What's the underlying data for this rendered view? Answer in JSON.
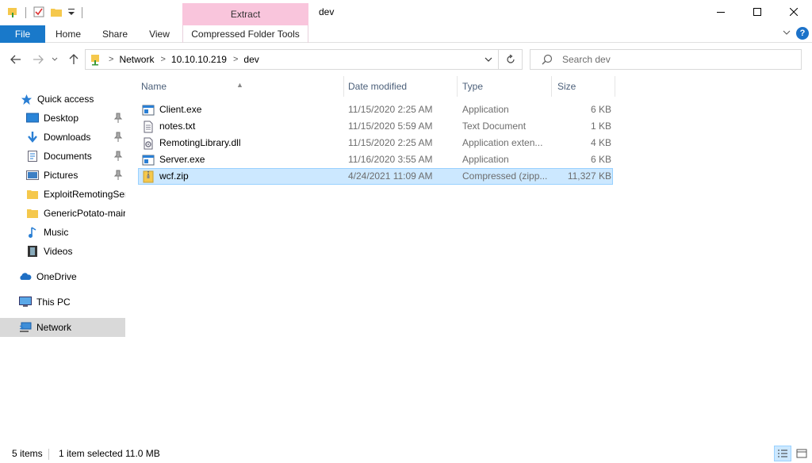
{
  "window": {
    "title": "dev",
    "context_tab_header": "Extract"
  },
  "ribbon": {
    "tabs": [
      "File",
      "Home",
      "Share",
      "View",
      "Compressed Folder Tools"
    ]
  },
  "address": {
    "crumbs": [
      "Network",
      "10.10.10.219",
      "dev"
    ],
    "search_placeholder": "Search dev"
  },
  "sidebar": {
    "items": [
      {
        "label": "Quick access",
        "icon": "star-icon",
        "pinned": false
      },
      {
        "label": "Desktop",
        "icon": "desktop-icon",
        "pinned": true
      },
      {
        "label": "Downloads",
        "icon": "download-arrow-icon",
        "pinned": true
      },
      {
        "label": "Documents",
        "icon": "documents-icon",
        "pinned": true
      },
      {
        "label": "Pictures",
        "icon": "pictures-icon",
        "pinned": true
      },
      {
        "label": "ExploitRemotingSer",
        "icon": "folder-icon",
        "pinned": false
      },
      {
        "label": "GenericPotato-mair",
        "icon": "folder-icon",
        "pinned": false
      },
      {
        "label": "Music",
        "icon": "music-note-icon",
        "pinned": false
      },
      {
        "label": "Videos",
        "icon": "film-icon",
        "pinned": false
      },
      {
        "label": "OneDrive",
        "icon": "cloud-icon",
        "pinned": false
      },
      {
        "label": "This PC",
        "icon": "computer-icon",
        "pinned": false
      },
      {
        "label": "Network",
        "icon": "network-icon",
        "pinned": false,
        "selected": true
      }
    ]
  },
  "files": {
    "columns": [
      "Name",
      "Date modified",
      "Type",
      "Size"
    ],
    "rows": [
      {
        "name": "Client.exe",
        "date": "11/15/2020 2:25 AM",
        "type": "Application",
        "size": "6 KB",
        "icon": "exe-icon"
      },
      {
        "name": "notes.txt",
        "date": "11/15/2020 5:59 AM",
        "type": "Text Document",
        "size": "1 KB",
        "icon": "text-file-icon"
      },
      {
        "name": "RemotingLibrary.dll",
        "date": "11/15/2020 2:25 AM",
        "type": "Application exten...",
        "size": "4 KB",
        "icon": "dll-icon"
      },
      {
        "name": "Server.exe",
        "date": "11/16/2020 3:55 AM",
        "type": "Application",
        "size": "6 KB",
        "icon": "exe-icon"
      },
      {
        "name": "wcf.zip",
        "date": "4/24/2021 11:09 AM",
        "type": "Compressed (zipp...",
        "size": "11,327 KB",
        "icon": "zip-folder-icon",
        "selected": true
      }
    ]
  },
  "status": {
    "item_count": "5 items",
    "selection": "1 item selected",
    "selection_size": "11.0 MB"
  },
  "colors": {
    "accent": "#1979ca",
    "context_tab": "#f9c5dc",
    "selection": "#cce8ff"
  }
}
